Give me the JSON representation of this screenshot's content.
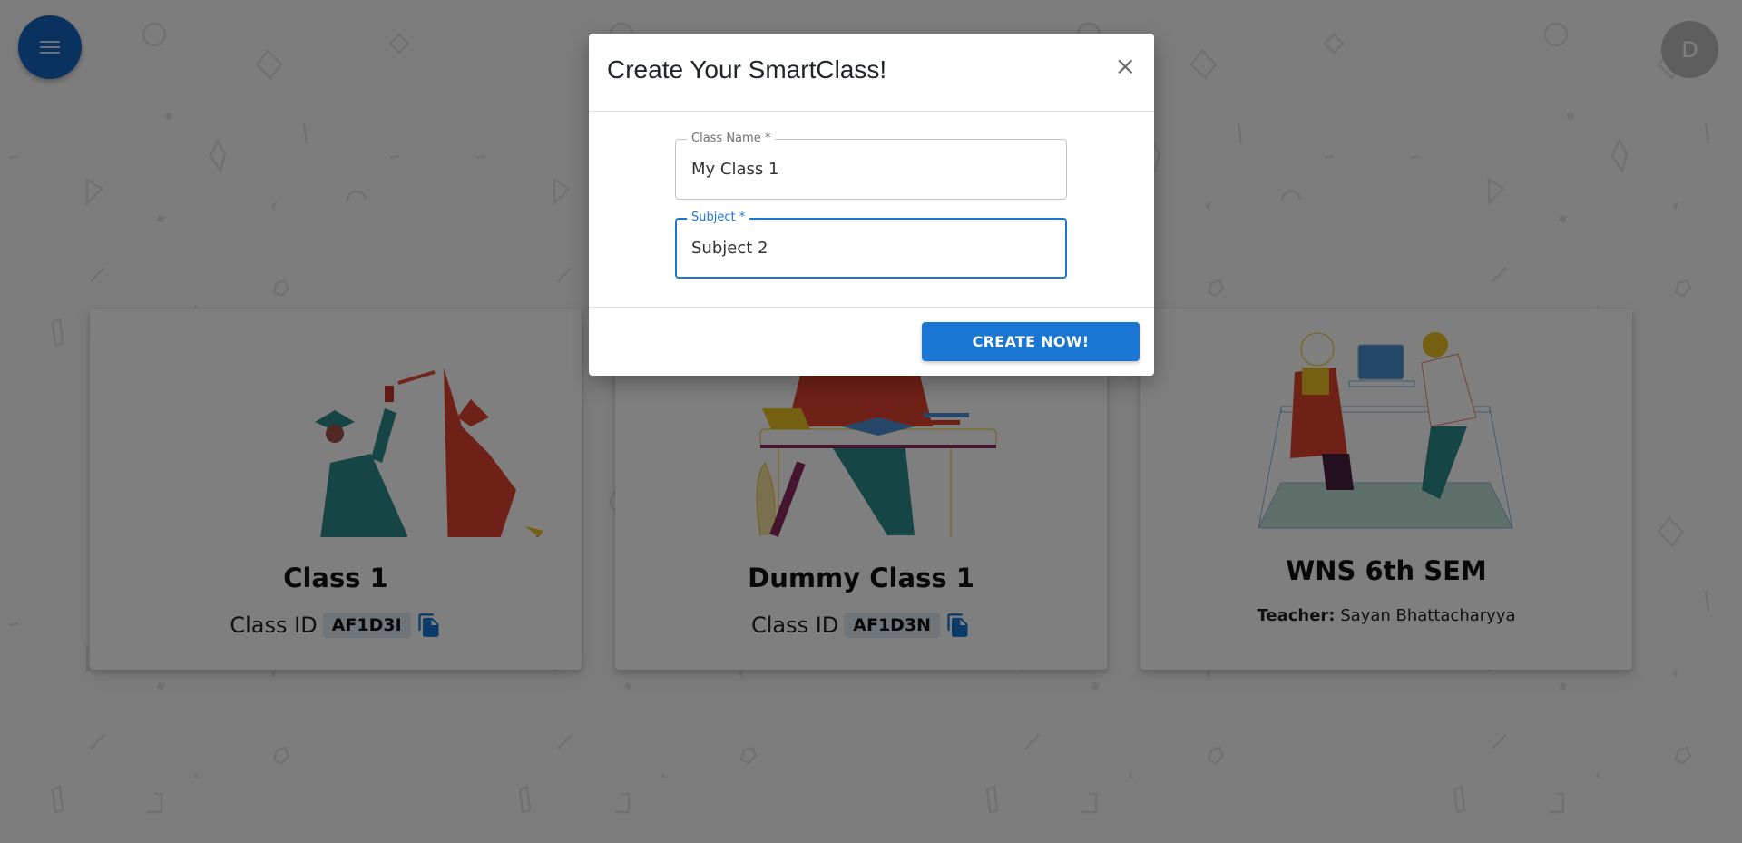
{
  "nav": {
    "menu_icon": "hamburger-menu-icon",
    "avatar_initial": "D"
  },
  "classes": [
    {
      "title": "Class 1",
      "id_label": "Class ID",
      "class_id": "AF1D3I",
      "illustration": "graduation-illustration"
    },
    {
      "title": "Dummy Class 1",
      "id_label": "Class ID",
      "class_id": "AF1D3N",
      "illustration": "student-studying-illustration"
    },
    {
      "title": "WNS 6th SEM",
      "teacher_label": "Teacher:",
      "teacher_name": "Sayan Bhattacharyya",
      "illustration": "online-class-illustration"
    }
  ],
  "modal": {
    "title": "Create Your SmartClass!",
    "close_label": "×",
    "fields": [
      {
        "label": "Class Name *",
        "value": "My Class 1"
      },
      {
        "label": "Subject *",
        "value": "Subject 2"
      }
    ],
    "submit_label": "CREATE NOW!"
  },
  "colors": {
    "primary": "#1976d2",
    "fab": "#1565c0",
    "avatar": "#bdbdbd",
    "chip": "#e1eaf3"
  }
}
